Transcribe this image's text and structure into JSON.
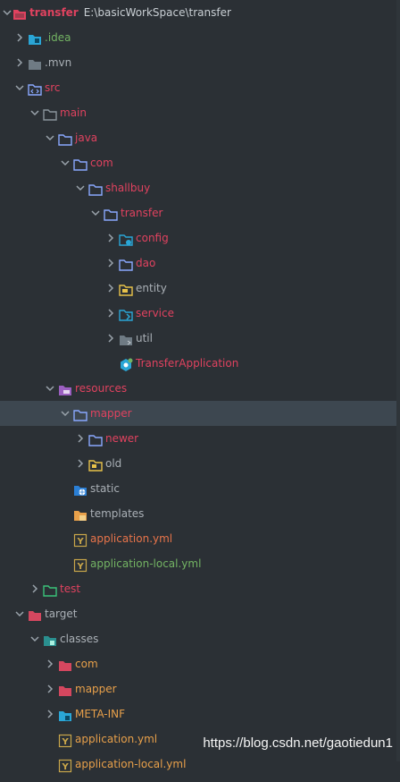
{
  "project": {
    "name": "transfer",
    "path": "E:\\basicWorkSpace\\transfer"
  },
  "colors": {
    "pink": "#e0425f",
    "gray": "#aab0b6",
    "green": "#73b363",
    "orange": "#e8a04a",
    "orange_text": "#e8744a",
    "light": "#c9cfd4"
  },
  "items": [
    {
      "label": "transfer",
      "level": 0,
      "expanded": true,
      "icon": "module-folder-icon"
    },
    {
      "label": ".idea",
      "level": 1,
      "expanded": false,
      "icon": "idea-folder-icon"
    },
    {
      "label": ".mvn",
      "level": 1,
      "expanded": false,
      "icon": "folder-icon"
    },
    {
      "label": "src",
      "level": 1,
      "expanded": true,
      "icon": "source-folder-icon"
    },
    {
      "label": "main",
      "level": 2,
      "expanded": true,
      "icon": "folder-icon"
    },
    {
      "label": "java",
      "level": 3,
      "expanded": true,
      "icon": "java-source-folder-icon"
    },
    {
      "label": "com",
      "level": 4,
      "expanded": true,
      "icon": "package-icon"
    },
    {
      "label": "shallbuy",
      "level": 5,
      "expanded": true,
      "icon": "package-icon"
    },
    {
      "label": "transfer",
      "level": 6,
      "expanded": true,
      "icon": "package-icon"
    },
    {
      "label": "config",
      "level": 7,
      "expanded": false,
      "icon": "config-package-icon"
    },
    {
      "label": "dao",
      "level": 7,
      "expanded": false,
      "icon": "package-icon"
    },
    {
      "label": "entity",
      "level": 7,
      "expanded": false,
      "icon": "entity-package-icon"
    },
    {
      "label": "service",
      "level": 7,
      "expanded": false,
      "icon": "service-package-icon"
    },
    {
      "label": "util",
      "level": 7,
      "expanded": false,
      "icon": "folder-icon"
    },
    {
      "label": "TransferApplication",
      "level": 7,
      "expanded": null,
      "icon": "spring-boot-class-icon"
    },
    {
      "label": "resources",
      "level": 3,
      "expanded": true,
      "icon": "resources-folder-icon"
    },
    {
      "label": "mapper",
      "level": 4,
      "expanded": true,
      "icon": "folder-icon"
    },
    {
      "label": "newer",
      "level": 5,
      "expanded": false,
      "icon": "folder-icon"
    },
    {
      "label": "old",
      "level": 5,
      "expanded": false,
      "icon": "folder-icon"
    },
    {
      "label": "static",
      "level": 4,
      "expanded": null,
      "icon": "web-folder-icon"
    },
    {
      "label": "templates",
      "level": 4,
      "expanded": null,
      "icon": "templates-folder-icon"
    },
    {
      "label": "application.yml",
      "level": 4,
      "expanded": null,
      "icon": "yaml-file-icon"
    },
    {
      "label": "application-local.yml",
      "level": 4,
      "expanded": null,
      "icon": "yaml-file-icon"
    },
    {
      "label": "test",
      "level": 2,
      "expanded": false,
      "icon": "test-folder-icon"
    },
    {
      "label": "target",
      "level": 1,
      "expanded": true,
      "icon": "excluded-folder-icon"
    },
    {
      "label": "classes",
      "level": 2,
      "expanded": true,
      "icon": "output-folder-icon"
    },
    {
      "label": "com",
      "level": 3,
      "expanded": false,
      "icon": "excluded-folder-icon"
    },
    {
      "label": "mapper",
      "level": 3,
      "expanded": false,
      "icon": "excluded-folder-icon"
    },
    {
      "label": "META-INF",
      "level": 3,
      "expanded": false,
      "icon": "meta-inf-folder-icon"
    },
    {
      "label": "application.yml",
      "level": 3,
      "expanded": null,
      "icon": "yaml-file-icon"
    },
    {
      "label": "application-local.yml",
      "level": 3,
      "expanded": null,
      "icon": "yaml-file-icon"
    }
  ],
  "watermark": "https://blog.csdn.net/gaotiedun1"
}
